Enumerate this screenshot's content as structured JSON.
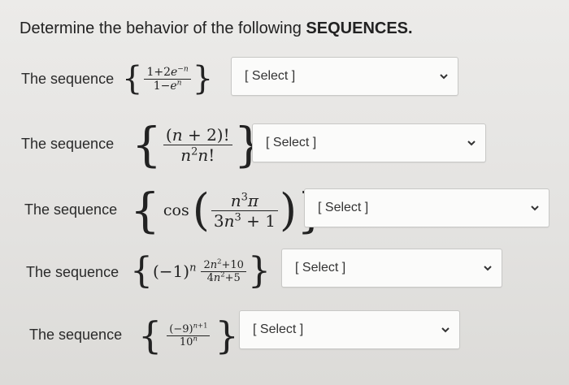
{
  "title_prefix": "Determine the behavior of the following ",
  "title_emphasis": "SEQUENCES.",
  "rows": [
    {
      "label": "The sequence",
      "select": "[ Select ]",
      "num": "1+2e−n",
      "den": "1−en"
    },
    {
      "label": "The sequence",
      "select": "[ Select ]",
      "num": "(n + 2)!",
      "den": "n2n!"
    },
    {
      "label": "The sequence",
      "select": "[ Select ]",
      "func": "cos",
      "num": "n3π",
      "den": "3n3 + 1"
    },
    {
      "label": "The sequence",
      "select": "[ Select ]",
      "prefix": "(−1)n",
      "num": "2n2+10",
      "den": "4n2+5"
    },
    {
      "label": "The sequence",
      "select": "[ Select ]",
      "num": "(−9)n+1",
      "den": "10n"
    }
  ],
  "chevron_icon": "chevron-down-icon"
}
